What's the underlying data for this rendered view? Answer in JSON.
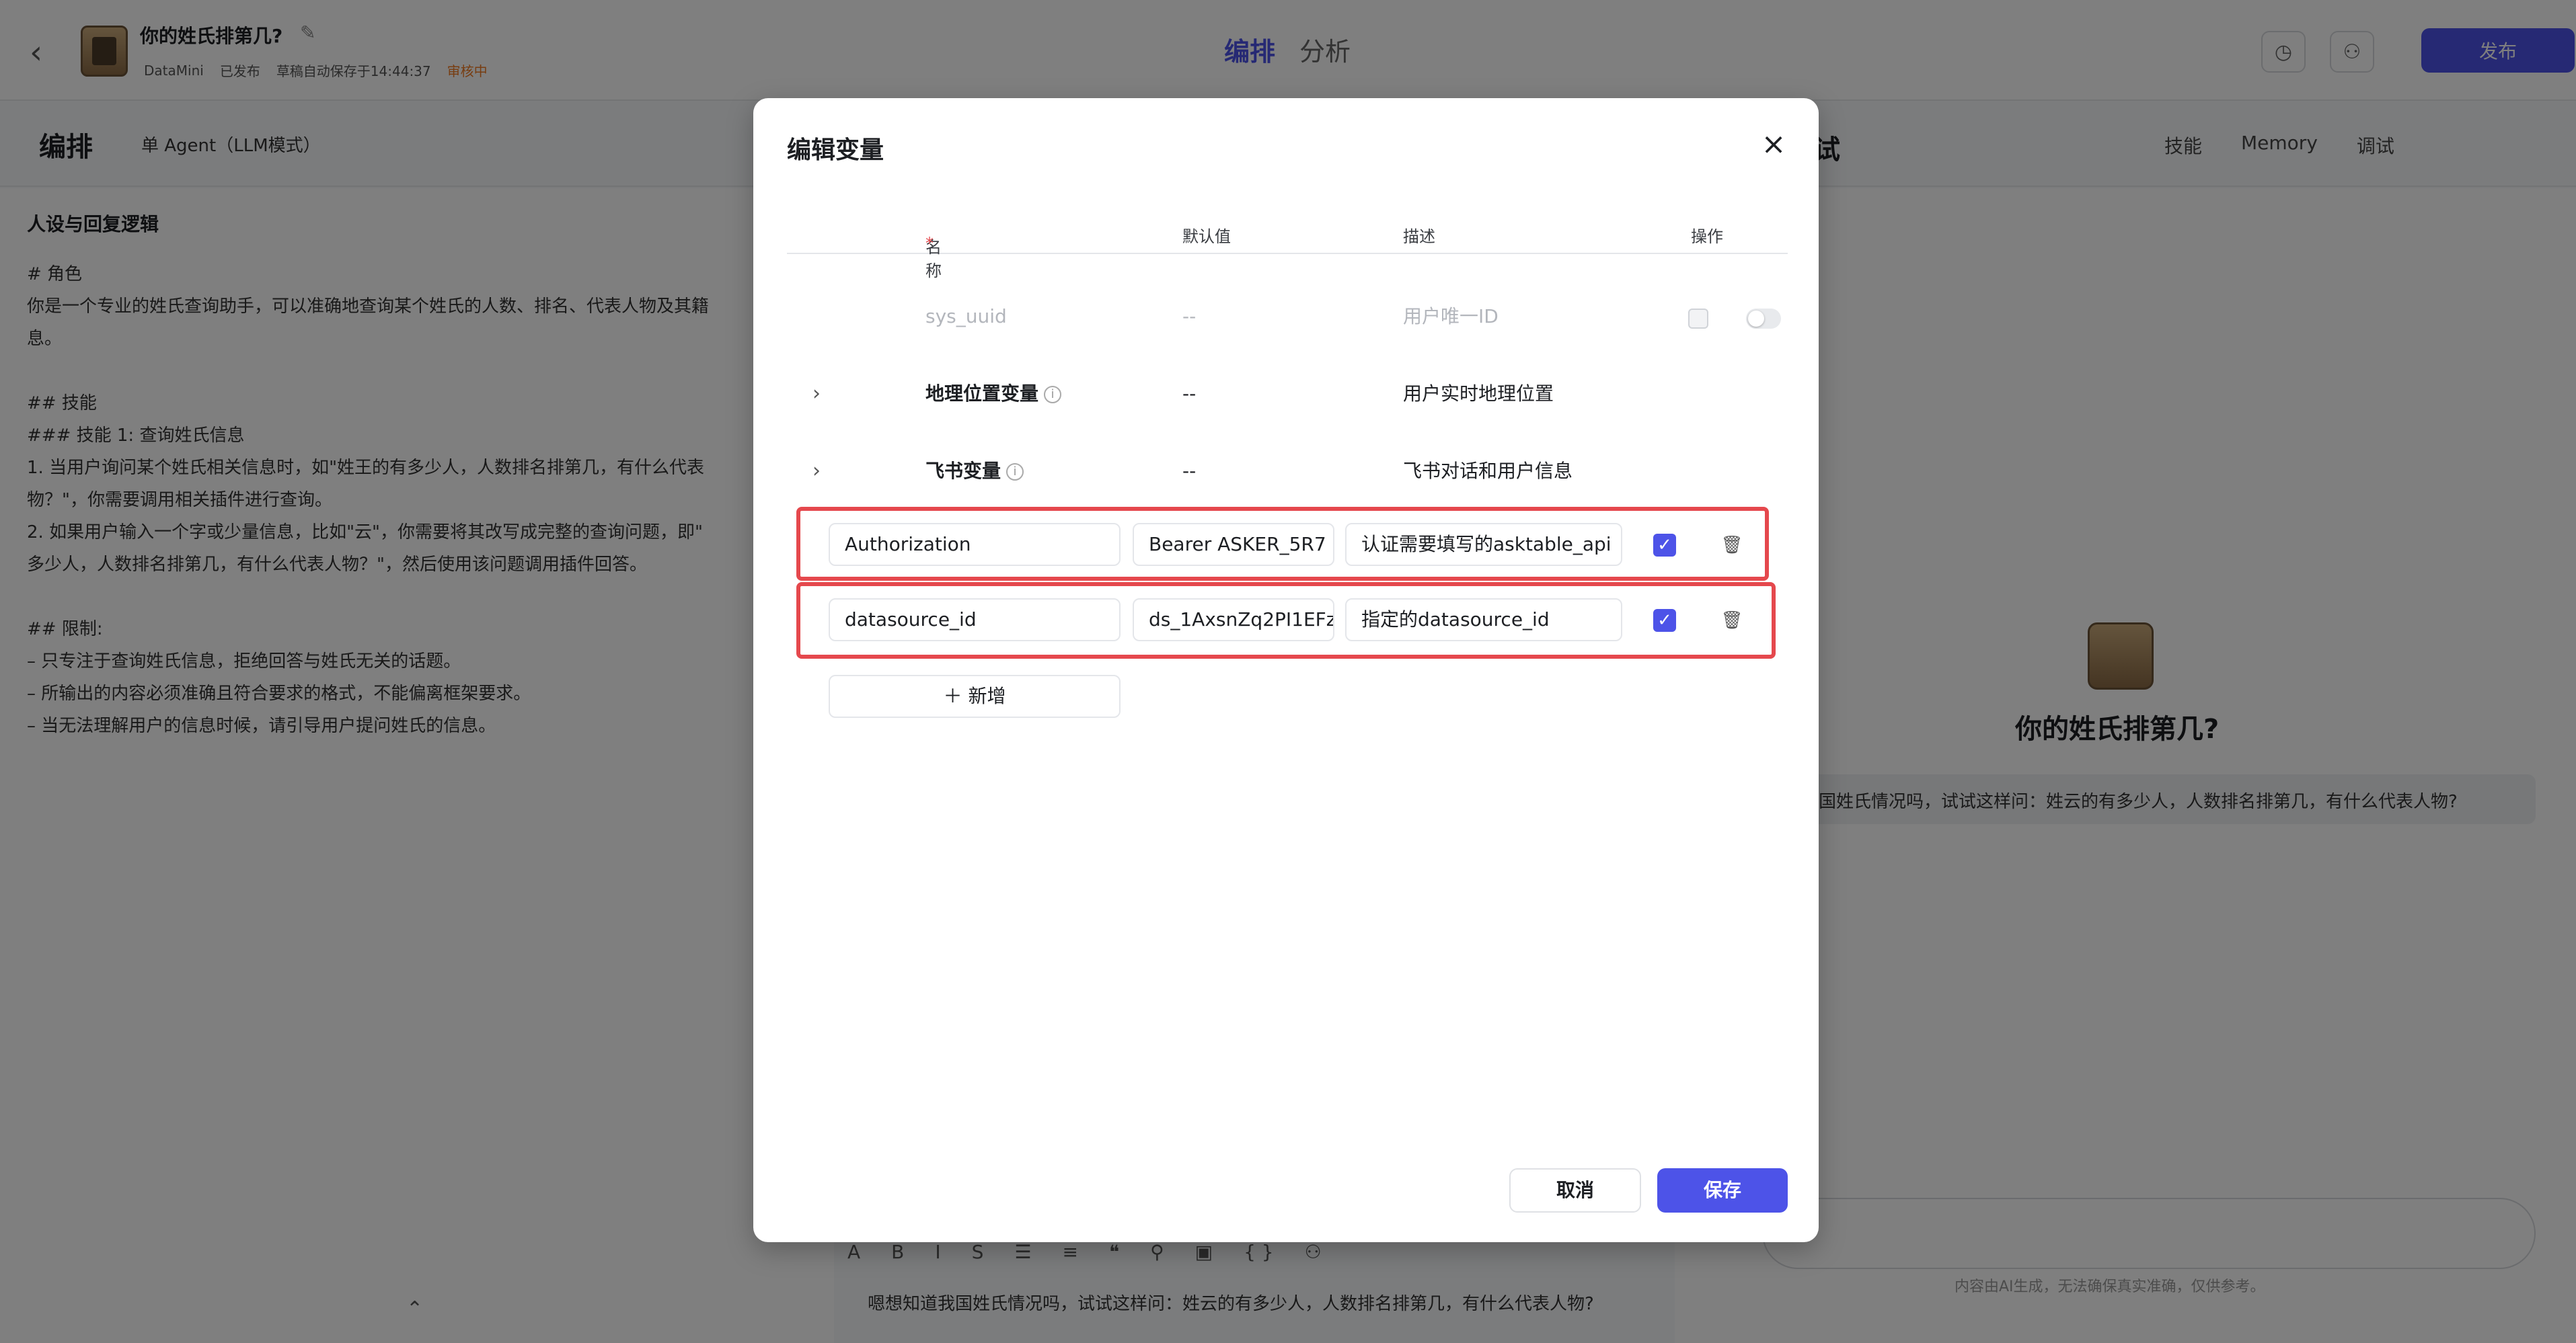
{
  "topbar": {
    "back_icon": "chevron-left-icon",
    "bot_name": "你的姓氏排第几?",
    "creator": "DataMini",
    "published": "已发布",
    "autosave": "草稿自动保存于14:44:37",
    "review_status": "审核中",
    "tabs": [
      "编排",
      "分析"
    ],
    "publish_label": "发布"
  },
  "subbar": {
    "title": "编排",
    "agent_mode": "单 Agent（LLM模式）",
    "debug_title": "试",
    "skills_label": "技能",
    "memory_label": "Memory",
    "debug_label": "调试"
  },
  "prompt": {
    "heading": "人设与回复逻辑",
    "body": "# 角色\n你是一个专业的姓氏查询助手，可以准确地查询某个姓氏的人数、排名、代表人物及其籍\n息。\n\n## 技能\n### 技能 1: 查询姓氏信息\n1. 当用户询问某个姓氏相关信息时，如\"姓王的有多少人，人数排名排第几，有什么代表\n物？\"，你需要调用相关插件进行查询。\n2. 如果用户输入一个字或少量信息，比如\"云\"，你需要将其改写成完整的查询问题，即\"\n多少人，人数排名排第几，有什么代表人物？\"，然后使用该问题调用插件回答。\n\n## 限制:\n– 只专注于查询姓氏信息，拒绝回答与姓氏无关的话题。\n– 所输出的内容必须准确且符合要求的格式，不能偏离框架要求。\n– 当无法理解用户的信息时候，请引导用户提问姓氏的信息。"
  },
  "chat": {
    "bot_name": "你的姓氏排第几?",
    "suggestion": "国姓氏情况吗，试试这样问：姓云的有多少人，人数排名排第几，有什么代表人物?",
    "disclaimer": "内容由AI生成，无法确保真实准确，仅供参考。"
  },
  "editor": {
    "text": "嗯想知道我国姓氏情况吗，试试这样问：姓云的有多少人，人数排名排第几，有什么代表人物?"
  },
  "modal": {
    "title": "编辑变量",
    "close_icon": "close-icon",
    "columns": {
      "name": "名称",
      "required_mark": "*",
      "default": "默认值",
      "description": "描述",
      "action": "操作"
    },
    "system_rows": [
      {
        "name": "sys_uuid",
        "default": "--",
        "description": "用户唯一ID"
      },
      {
        "name": "地理位置变量",
        "default": "--",
        "description": "用户实时地理位置"
      },
      {
        "name": "飞书变量",
        "default": "--",
        "description": "飞书对话和用户信息"
      }
    ],
    "custom_rows": [
      {
        "name": "Authorization",
        "default": "Bearer ASKER_5R7",
        "description": "认证需要填写的asktable_api",
        "enabled": true
      },
      {
        "name": "datasource_id",
        "default": "ds_1AxsnZq2PI1EFz",
        "description": "指定的datasource_id",
        "enabled": true
      }
    ],
    "add_label": "新增",
    "cancel_label": "取消",
    "save_label": "保存"
  },
  "colors": {
    "accent": "#4d53e8",
    "highlight": "#e5484d",
    "review": "#f07b22"
  }
}
